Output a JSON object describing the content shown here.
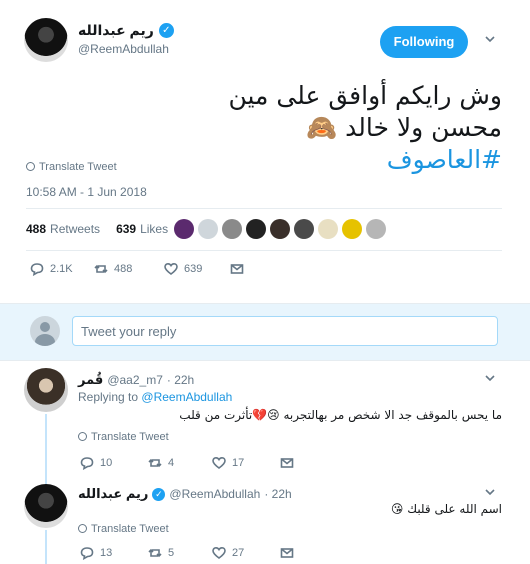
{
  "main_tweet": {
    "display_name": "ريم عبدالله",
    "handle": "@ReemAbdullah",
    "follow_label": "Following",
    "text_line1": "وش رايكم أوافق على مين",
    "text_line2": "محسن ولا خالد 🙈",
    "hashtag": "#العاصوف",
    "translate_label": "Translate Tweet",
    "timestamp": "10:58 AM - 1 Jun 2018",
    "retweets_count": "488",
    "retweets_label": "Retweets",
    "likes_count": "639",
    "likes_label": "Likes",
    "actions": {
      "replies": "2.1K",
      "retweets": "488",
      "likes": "639"
    }
  },
  "reply_box": {
    "placeholder": "Tweet your reply"
  },
  "replies": [
    {
      "display_name": "قُمر",
      "handle": "@aa2_m7",
      "time": "· 22h",
      "replying_to_label": "Replying to",
      "replying_to_handle": "@ReemAbdullah",
      "text": "ما يحس بالموقف جد الا شخص مر بهالتجربه 😢💔تأثرت من قلب",
      "translate_label": "Translate Tweet",
      "actions": {
        "replies": "10",
        "retweets": "4",
        "likes": "17"
      }
    },
    {
      "display_name": "ريم عبدالله",
      "handle": "@ReemAbdullah",
      "time": "· 22h",
      "text": "اسم الله على قلبك 😘",
      "translate_label": "Translate Tweet",
      "actions": {
        "replies": "13",
        "retweets": "5",
        "likes": "27"
      }
    }
  ],
  "colors": {
    "accent": "#1da1f2",
    "link": "#1b95e0",
    "muted": "#657786"
  }
}
